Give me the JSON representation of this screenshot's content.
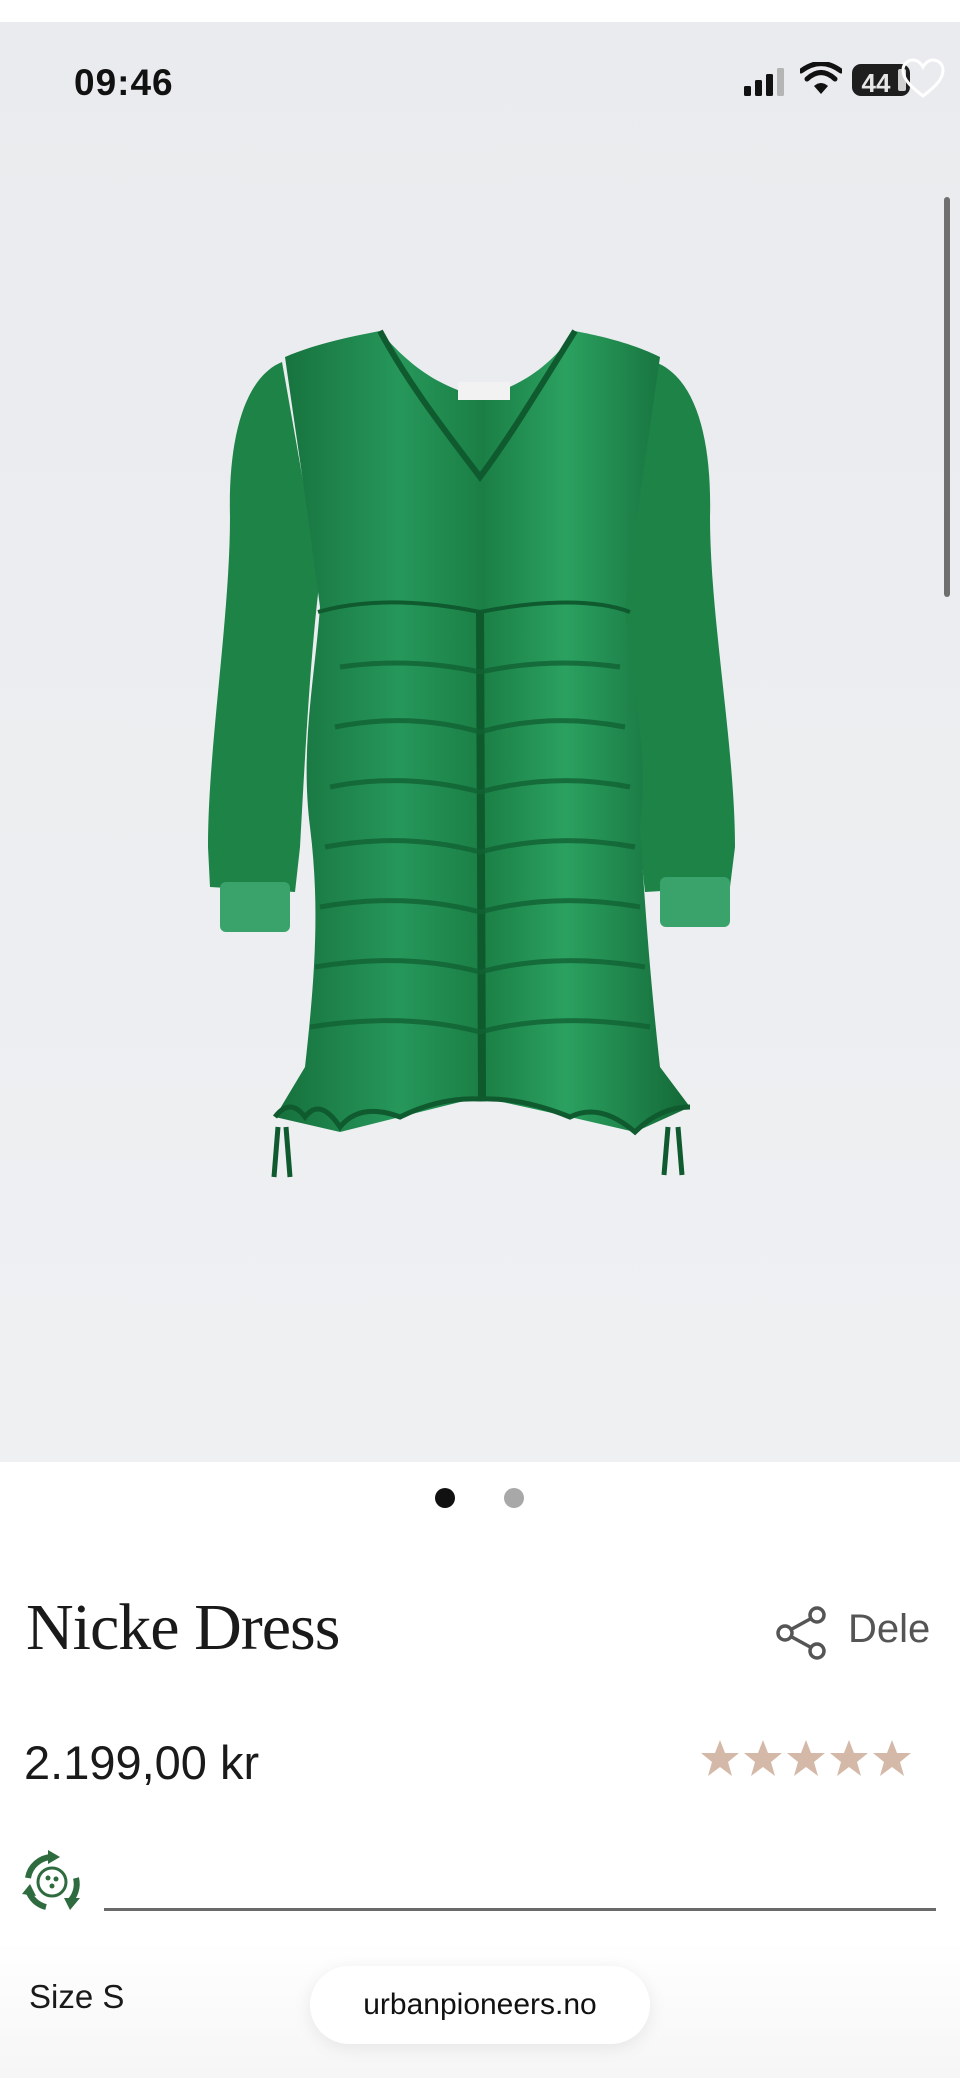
{
  "status_bar": {
    "time": "09:46",
    "battery": "44"
  },
  "icons": {
    "signal": "signal-icon",
    "wifi": "wifi-icon",
    "battery": "battery-icon",
    "favorite": "heart-icon",
    "share": "share-icon",
    "rating": "star-icon",
    "eco": "recycle-icon"
  },
  "product": {
    "name": "Nicke Dress",
    "share_label": "Dele",
    "price": "2.199,00 kr",
    "rating": 5,
    "rating_max": 5,
    "size_label": "Size S"
  },
  "carousel": {
    "current": 1,
    "total": 2
  },
  "browser": {
    "url": "urbanpioneers.no"
  },
  "colors": {
    "dress": "#1f8a4c",
    "star": "#d4b8a8",
    "eco": "#2e6b3e"
  }
}
